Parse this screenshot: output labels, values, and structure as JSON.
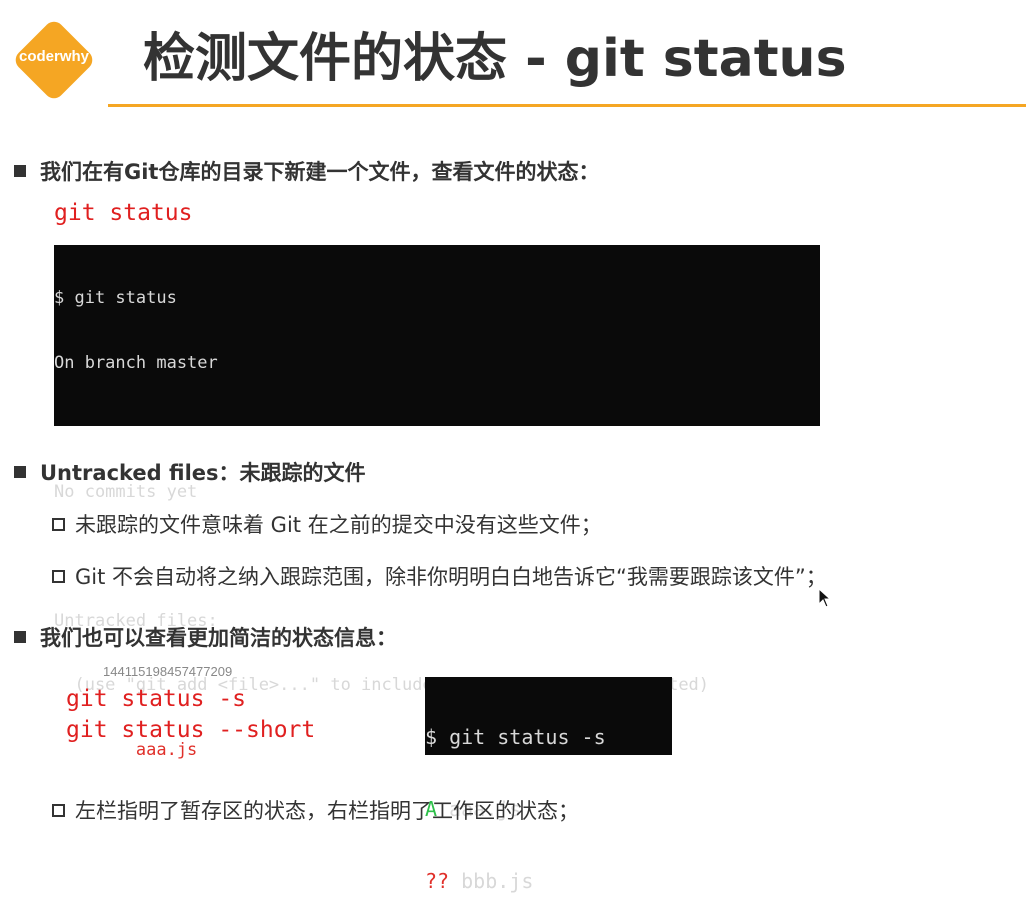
{
  "logo": {
    "text": "coderwhy",
    "color": "#f5a623"
  },
  "title": "检测文件的状态 - git status",
  "accent_color": "#f5a623",
  "section1": {
    "heading": "我们在有Git仓库的目录下新建一个文件，查看文件的状态：",
    "command": "git status",
    "terminal_lines": [
      "$ git status",
      "On branch master",
      "",
      "No commits yet",
      "",
      "Untracked files:",
      "  (use \"git add <file>...\" to include in what will be committed)",
      "        aaa.js"
    ]
  },
  "section2": {
    "heading": "Untracked files：未跟踪的文件",
    "items": [
      "未跟踪的文件意味着 Git 在之前的提交中没有这些文件；",
      "Git 不会自动将之纳入跟踪范围，除非你明明白白地告诉它“我需要跟踪该文件”；"
    ]
  },
  "section3": {
    "heading": "我们也可以查看更加简洁的状态信息：",
    "id_text": "144115198457477209",
    "commands": [
      "git status -s",
      "git status --short"
    ],
    "terminal": {
      "prompt": "$ git status -s",
      "rows": [
        {
          "status": "A",
          "file": " aaa.js",
          "color": "#2ec04a"
        },
        {
          "status": "??",
          "file": " bbb.js",
          "color": "#e0302a"
        }
      ]
    },
    "note": "左栏指明了暂存区的状态，右栏指明了工作区的状态；"
  }
}
